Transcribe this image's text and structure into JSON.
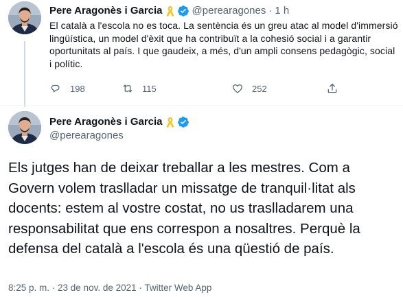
{
  "tweet1": {
    "author_name": "Pere Aragonès i Garcia",
    "handle": "@perearagones",
    "separator": "·",
    "time": "1 h",
    "text": "El català a l'escola no es toca. La sentència és un greu atac al model d'immersió lingüística, un model d'èxit que ha contribuït a la cohesió social i a garantir oportunitats al país. I que gaudeix, a més, d'un ampli consens pedagògic, social i polític.",
    "replies": "198",
    "retweets": "115",
    "likes": "252"
  },
  "tweet2": {
    "author_name": "Pere Aragonès i Garcia",
    "handle": "@perearagones",
    "text": "Els jutges han de deixar treballar a les mestres. Com a Govern volem traslladar un missatge de tranquil·litat als docents: estem al vostre costat, no us traslladarem una responsabilitat que ens correspon a nosaltres. Perquè la defensa del català a l'escola és una qüestió de país.",
    "meta": "8:25 p. m. · 23 de nov. de 2021 · Twitter Web App"
  },
  "icons": {
    "ribbon": "yellow-ribbon-icon",
    "verified": "verified-badge-icon",
    "reply": "reply-icon",
    "retweet": "retweet-icon",
    "like": "heart-icon",
    "share": "share-icon"
  },
  "colors": {
    "text": "#0f1419",
    "secondary": "#536471",
    "verified": "#1d9bf0",
    "ribbon": "#f5c518",
    "divider": "#eff3f4"
  }
}
